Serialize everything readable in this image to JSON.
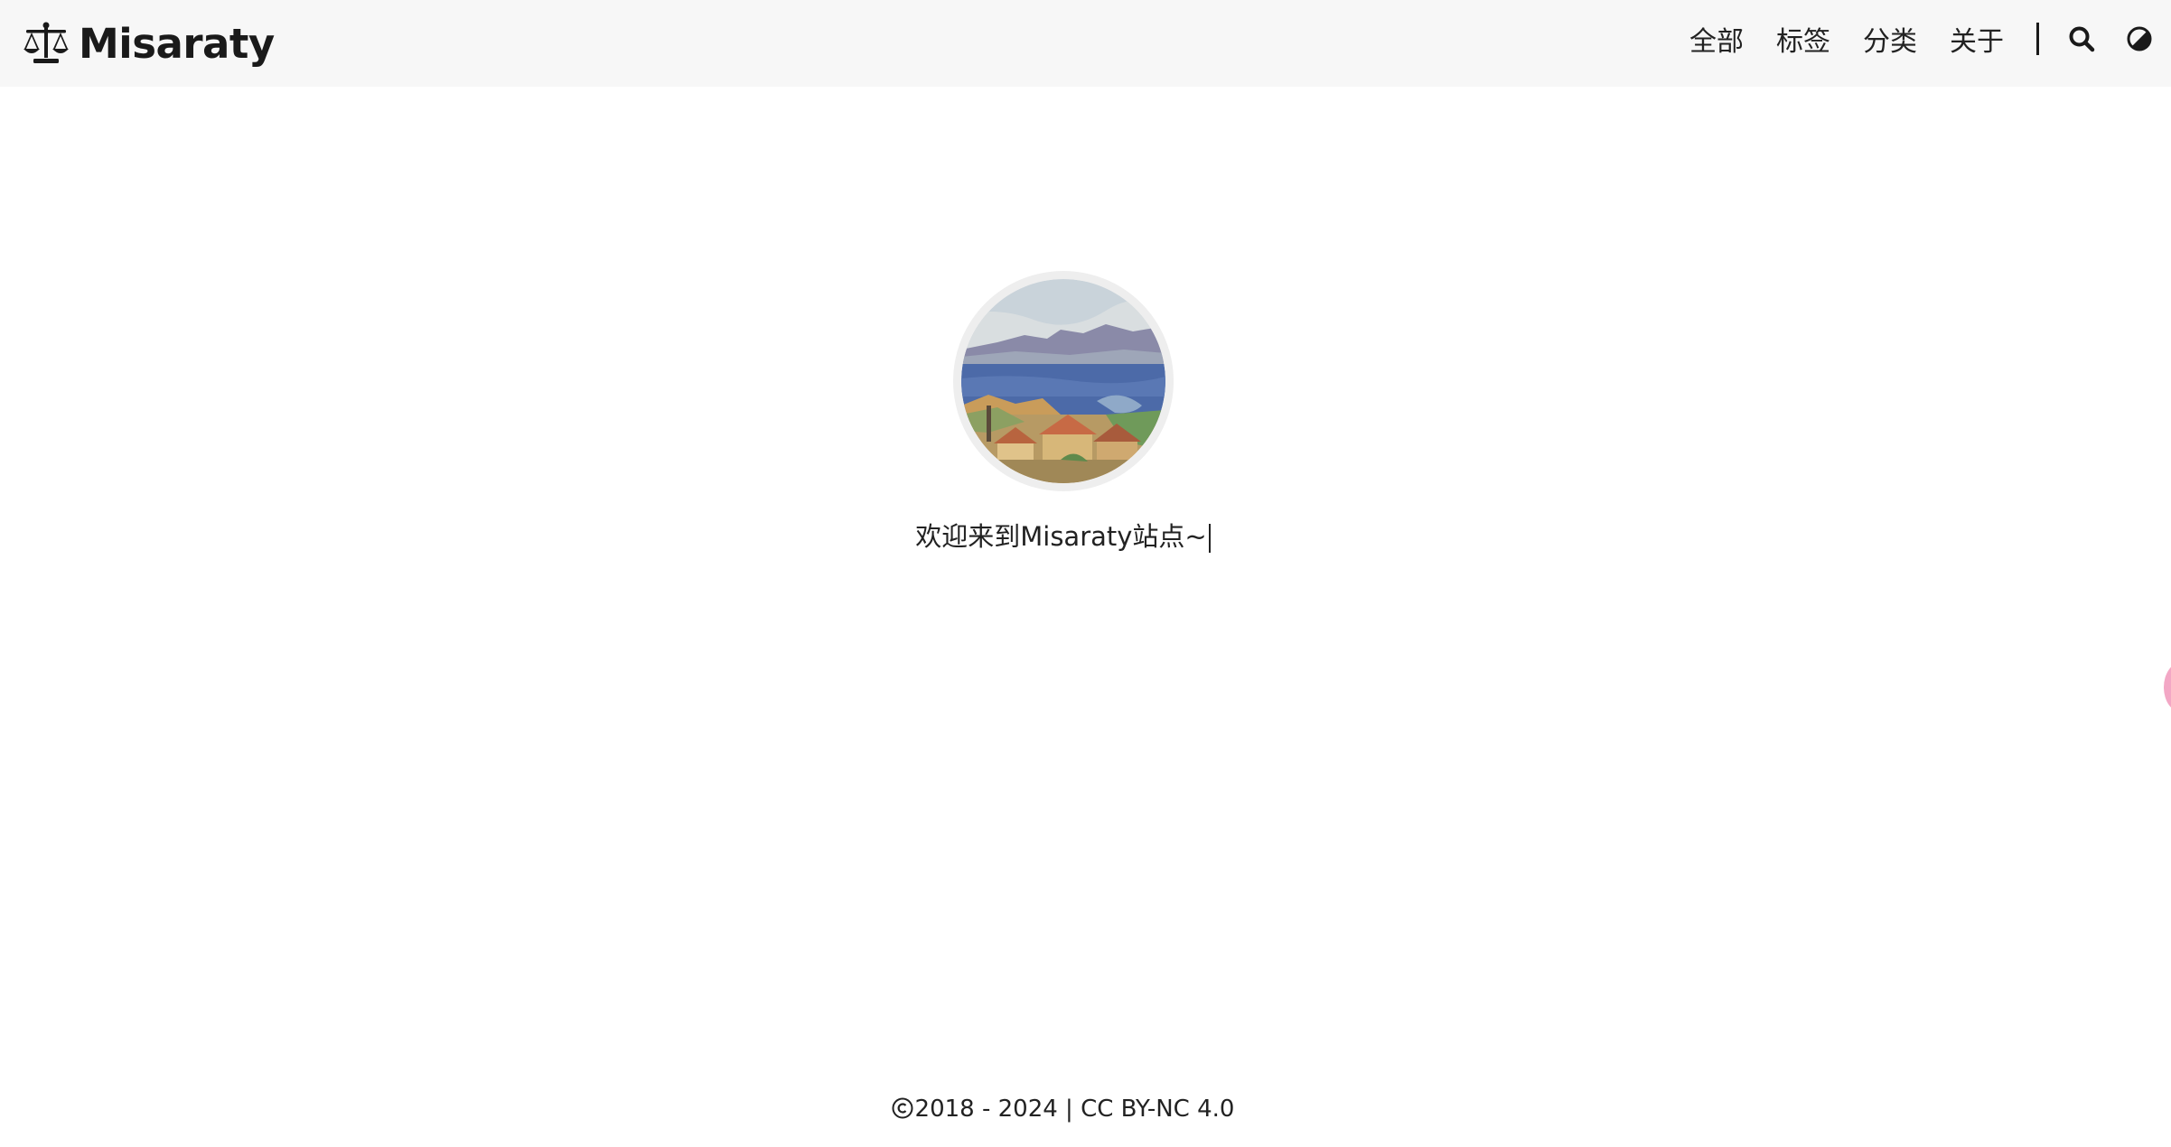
{
  "brand": {
    "name": "Misaraty",
    "logo_icon": "balance-scale-icon"
  },
  "nav": {
    "items": [
      {
        "label": "全部"
      },
      {
        "label": "标签"
      },
      {
        "label": "分类"
      },
      {
        "label": "关于"
      }
    ],
    "search_icon": "search-icon",
    "theme_icon": "theme-toggle-icon"
  },
  "hero": {
    "avatar_icon": "avatar-landscape-painting",
    "welcome_text": "欢迎来到Misaraty站点~"
  },
  "footer": {
    "copyright_icon": "copyright-icon",
    "text": "2018 - 2024 | CC BY-NC 4.0"
  },
  "colors": {
    "header_bg": "#f7f7f7",
    "page_bg": "#ffffff",
    "text": "#222222",
    "side_widget": "#f3a7c5"
  }
}
